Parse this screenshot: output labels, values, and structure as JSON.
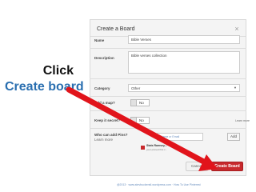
{
  "dialog": {
    "title": "Create a Board",
    "close_glyph": "×",
    "name_label": "Name",
    "name_value": "Bible Verses",
    "description_label": "Description",
    "description_value": "Bible verses collection",
    "category_label": "Category",
    "category_value": "Other",
    "map_label": "Add a map?",
    "map_toggle": "No",
    "secret_label": "Keep it secret?",
    "secret_toggle": "No",
    "learn_more": "Learn more",
    "who_label": "Who can add Pins?",
    "who_learn_more": "Learn more",
    "collaborator_placeholder": "Name or Email",
    "add_button": "Add",
    "notice_title": "Stats Ramsey...",
    "notice_text": "your pinned first c...",
    "cancel_button": "Cancel",
    "create_button": "Create Board"
  },
  "callout": {
    "line1": "Click",
    "line2": "Create board"
  },
  "footer": "@2013 · www.stevbuckerstl.wordpress.com · How To Use Pinterest",
  "colors": {
    "accent_red": "#c8292d",
    "callout_blue": "#2a6fb0",
    "arrow_red": "#e1141b"
  },
  "icons": {
    "close": "close-icon",
    "dropdown": "chevron-down-icon",
    "arrow": "arrow-icon"
  }
}
